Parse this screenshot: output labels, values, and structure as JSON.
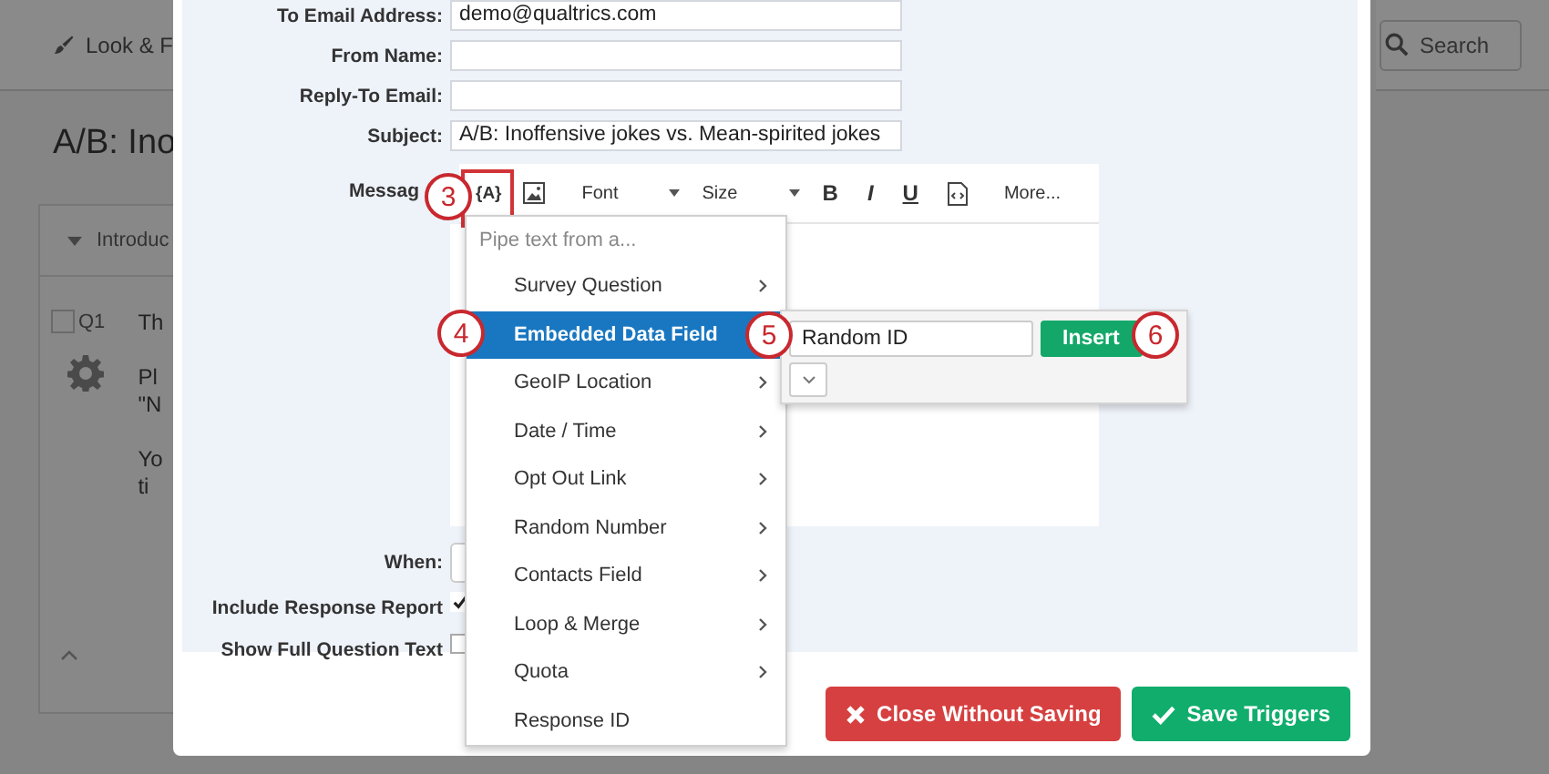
{
  "background": {
    "toolbar_item": "Look & F",
    "search_placeholder": "Search",
    "page_title": "A/B: Ino",
    "block_title": "Introduc",
    "question": {
      "number": "Q1",
      "checked": false
    },
    "paragraphs": [
      {
        "lines": [
          "Th"
        ]
      },
      {
        "lines": [
          "Pl",
          "\"N"
        ]
      },
      {
        "lines": [
          "Yo",
          "ti"
        ]
      }
    ]
  },
  "form": {
    "fields": [
      {
        "label": "To Email Address:",
        "value": "demo@qualtrics.com"
      },
      {
        "label": "From Name:"
      },
      {
        "label": "Reply-To Email:"
      },
      {
        "label": "Subject:",
        "value": "A/B: Inoffensive jokes vs. Mean-spirited jokes"
      }
    ],
    "message_label": "Messag",
    "toolbar": [
      {
        "kind": "piping",
        "label": "{A}"
      },
      {
        "kind": "image"
      },
      {
        "kind": "dropdown",
        "label": "Font"
      },
      {
        "kind": "dropdown",
        "label": "Size"
      },
      {
        "kind": "bold",
        "label": "B"
      },
      {
        "kind": "italic",
        "label": "I"
      },
      {
        "kind": "underline",
        "label": "U"
      },
      {
        "kind": "source"
      },
      {
        "kind": "text",
        "label": "More..."
      }
    ],
    "when_label": "When:",
    "options": [
      {
        "label": "Include Response Report",
        "checked": true
      },
      {
        "label": "Show Full Question Text",
        "checked": false
      }
    ]
  },
  "pipe_menu": {
    "header": "Pipe text from a...",
    "items": [
      {
        "label": "Survey Question",
        "selected": false,
        "has_submenu": true
      },
      {
        "label": "Embedded Data Field",
        "selected": true,
        "has_submenu": true
      },
      {
        "label": "GeoIP Location",
        "selected": false,
        "has_submenu": true
      },
      {
        "label": "Date / Time",
        "selected": false,
        "has_submenu": true
      },
      {
        "label": "Opt Out Link",
        "selected": false,
        "has_submenu": true
      },
      {
        "label": "Random Number",
        "selected": false,
        "has_submenu": true
      },
      {
        "label": "Contacts Field",
        "selected": false,
        "has_submenu": true
      },
      {
        "label": "Loop & Merge",
        "selected": false,
        "has_submenu": true
      },
      {
        "label": "Quota",
        "selected": false,
        "has_submenu": true
      },
      {
        "label": "Response ID",
        "selected": false,
        "has_submenu": false
      }
    ]
  },
  "embedded_field_popup": {
    "value": "Random ID",
    "button": "Insert"
  },
  "callouts": [
    "3",
    "4",
    "5",
    "6"
  ],
  "buttons": [
    {
      "kind": "cancel",
      "label": "Close Without Saving"
    },
    {
      "kind": "save",
      "label": "Save Triggers"
    }
  ]
}
